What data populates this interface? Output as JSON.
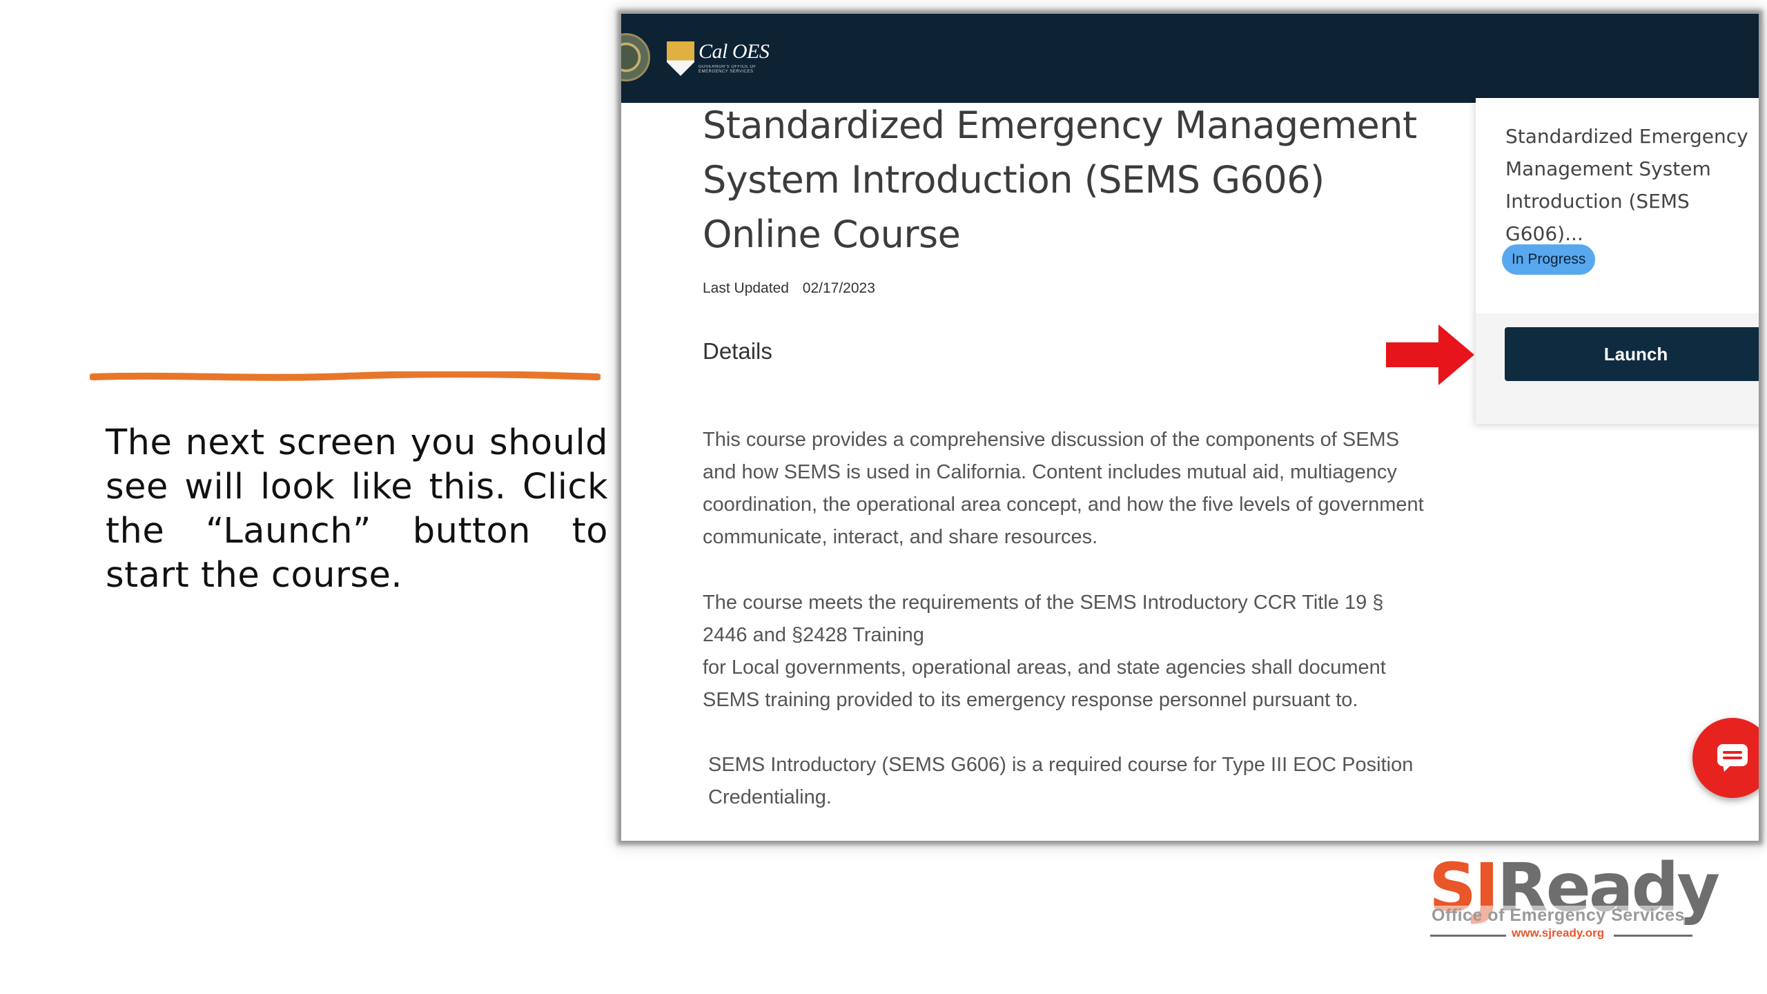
{
  "slide": {
    "instruction": "The next screen you should see will look like this. Click the “Launch” button to start the course."
  },
  "header": {
    "brand": "Cal OES",
    "brand_sub": "GOVERNOR'S OFFICE OF EMERGENCY SERVICES"
  },
  "course": {
    "title": "Standardized Emergency Management System Introduction (SEMS G606) Online Course",
    "last_updated_label": "Last Updated",
    "last_updated_value": "02/17/2023",
    "details_heading": "Details",
    "paragraph1": "This course provides a comprehensive discussion of the components of SEMS and how SEMS is used in California. Content includes mutual aid, multiagency coordination, the operational area concept, and how the five levels of government communicate, interact, and share resources.",
    "paragraph2a": "The course meets the requirements of the SEMS Introductory CCR Title 19 § 2446 and §2428  Training",
    "paragraph2b": "for Local governments, operational areas, and state agencies shall document SEMS training provided to its emergency response personnel pursuant to.",
    "paragraph3": "SEMS Introductory (SEMS G606) is a required course for Type III EOC Position Credentialing."
  },
  "sidebar": {
    "title": "Standardized Emergency\nManagement System\nIntroduction (SEMS G606)...",
    "status_badge": "In Progress",
    "launch_label": "Launch"
  },
  "logo": {
    "sj": "SJ",
    "ready": "Ready",
    "subtitle": "Office of Emergency Services",
    "url": "www.sjready.org"
  },
  "colors": {
    "header_bg": "#0d2233",
    "launch_bg": "#0f2b40",
    "badge_bg": "#58a8f0",
    "arrow": "#e8141b",
    "chat_button": "#e7231f",
    "accent_orange": "#e8562a"
  },
  "icons": [
    "state-seal-icon",
    "cal-oes-shield-icon",
    "red-arrow-icon",
    "chat-icon"
  ]
}
